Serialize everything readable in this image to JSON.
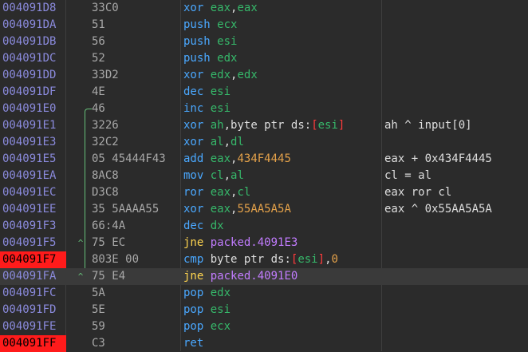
{
  "rows": [
    {
      "addr": "004091D8",
      "bytes": "33C0",
      "asm": [
        {
          "t": "mn",
          "v": "xor"
        },
        {
          "t": "sp",
          "v": " "
        },
        {
          "t": "reg",
          "v": "eax"
        },
        {
          "t": "txt",
          "v": ","
        },
        {
          "t": "reg",
          "v": "eax"
        }
      ],
      "comment": ""
    },
    {
      "addr": "004091DA",
      "bytes": "51",
      "asm": [
        {
          "t": "mn",
          "v": "push"
        },
        {
          "t": "sp",
          "v": " "
        },
        {
          "t": "reg",
          "v": "ecx"
        }
      ],
      "comment": ""
    },
    {
      "addr": "004091DB",
      "bytes": "56",
      "asm": [
        {
          "t": "mn",
          "v": "push"
        },
        {
          "t": "sp",
          "v": " "
        },
        {
          "t": "reg",
          "v": "esi"
        }
      ],
      "comment": ""
    },
    {
      "addr": "004091DC",
      "bytes": "52",
      "asm": [
        {
          "t": "mn",
          "v": "push"
        },
        {
          "t": "sp",
          "v": " "
        },
        {
          "t": "reg",
          "v": "edx"
        }
      ],
      "comment": ""
    },
    {
      "addr": "004091DD",
      "bytes": "33D2",
      "asm": [
        {
          "t": "mn",
          "v": "xor"
        },
        {
          "t": "sp",
          "v": " "
        },
        {
          "t": "reg",
          "v": "edx"
        },
        {
          "t": "txt",
          "v": ","
        },
        {
          "t": "reg",
          "v": "edx"
        }
      ],
      "comment": ""
    },
    {
      "addr": "004091DF",
      "bytes": "4E",
      "asm": [
        {
          "t": "mn",
          "v": "dec"
        },
        {
          "t": "sp",
          "v": " "
        },
        {
          "t": "reg",
          "v": "esi"
        }
      ],
      "comment": ""
    },
    {
      "addr": "004091E0",
      "bytes": "46",
      "asm": [
        {
          "t": "mn",
          "v": "inc"
        },
        {
          "t": "sp",
          "v": " "
        },
        {
          "t": "reg",
          "v": "esi"
        }
      ],
      "comment": ""
    },
    {
      "addr": "004091E1",
      "bytes": "3226",
      "asm": [
        {
          "t": "mn",
          "v": "xor"
        },
        {
          "t": "sp",
          "v": " "
        },
        {
          "t": "reg",
          "v": "ah"
        },
        {
          "t": "txt",
          "v": ","
        },
        {
          "t": "ptr",
          "v": "byte ptr "
        },
        {
          "t": "seg",
          "v": "ds:"
        },
        {
          "t": "br",
          "v": "["
        },
        {
          "t": "reg",
          "v": "esi"
        },
        {
          "t": "br",
          "v": "]"
        }
      ],
      "comment": "ah ^ input[0]"
    },
    {
      "addr": "004091E3",
      "bytes": "32C2",
      "asm": [
        {
          "t": "mn",
          "v": "xor"
        },
        {
          "t": "sp",
          "v": " "
        },
        {
          "t": "reg",
          "v": "al"
        },
        {
          "t": "txt",
          "v": ","
        },
        {
          "t": "reg",
          "v": "dl"
        }
      ],
      "comment": ""
    },
    {
      "addr": "004091E5",
      "bytes": "05 45444F43",
      "asm": [
        {
          "t": "mn",
          "v": "add"
        },
        {
          "t": "sp",
          "v": " "
        },
        {
          "t": "reg",
          "v": "eax"
        },
        {
          "t": "txt",
          "v": ","
        },
        {
          "t": "imm",
          "v": "434F4445"
        }
      ],
      "comment": "eax + 0x434F4445"
    },
    {
      "addr": "004091EA",
      "bytes": "8AC8",
      "asm": [
        {
          "t": "mn",
          "v": "mov"
        },
        {
          "t": "sp",
          "v": " "
        },
        {
          "t": "reg",
          "v": "cl"
        },
        {
          "t": "txt",
          "v": ","
        },
        {
          "t": "reg",
          "v": "al"
        }
      ],
      "comment": "cl = al"
    },
    {
      "addr": "004091EC",
      "bytes": "D3C8",
      "asm": [
        {
          "t": "mn",
          "v": "ror"
        },
        {
          "t": "sp",
          "v": " "
        },
        {
          "t": "reg",
          "v": "eax"
        },
        {
          "t": "txt",
          "v": ","
        },
        {
          "t": "reg",
          "v": "cl"
        }
      ],
      "comment": "eax ror cl"
    },
    {
      "addr": "004091EE",
      "bytes": "35 5AAAA55",
      "asm": [
        {
          "t": "mn",
          "v": "xor"
        },
        {
          "t": "sp",
          "v": " "
        },
        {
          "t": "reg",
          "v": "eax"
        },
        {
          "t": "txt",
          "v": ","
        },
        {
          "t": "imm",
          "v": "55AA5A5A"
        }
      ],
      "comment": "eax ^ 0x55AA5A5A"
    },
    {
      "addr": "004091F3",
      "bytes": "66:4A",
      "asm": [
        {
          "t": "mn",
          "v": "dec"
        },
        {
          "t": "sp",
          "v": " "
        },
        {
          "t": "reg",
          "v": "dx"
        }
      ],
      "comment": ""
    },
    {
      "addr": "004091F5",
      "bytes": "75 EC",
      "asm": [
        {
          "t": "mnj",
          "v": "jne"
        },
        {
          "t": "sp",
          "v": " "
        },
        {
          "t": "lbl",
          "v": "packed.4091E3"
        }
      ],
      "comment": "",
      "mark": "^"
    },
    {
      "addr": "004091F7",
      "bytes": "803E 00",
      "asm": [
        {
          "t": "mn",
          "v": "cmp"
        },
        {
          "t": "sp",
          "v": " "
        },
        {
          "t": "ptr",
          "v": "byte ptr "
        },
        {
          "t": "seg",
          "v": "ds:"
        },
        {
          "t": "br",
          "v": "["
        },
        {
          "t": "reg",
          "v": "esi"
        },
        {
          "t": "br",
          "v": "]"
        },
        {
          "t": "txt",
          "v": ","
        },
        {
          "t": "num",
          "v": "0"
        }
      ],
      "comment": "",
      "bp": true
    },
    {
      "addr": "004091FA",
      "bytes": "75 E4",
      "asm": [
        {
          "t": "mnj",
          "v": "jne"
        },
        {
          "t": "sp",
          "v": " "
        },
        {
          "t": "lbl",
          "v": "packed.4091E0"
        }
      ],
      "comment": "",
      "hl": true,
      "mark": "^"
    },
    {
      "addr": "004091FC",
      "bytes": "5A",
      "asm": [
        {
          "t": "mn",
          "v": "pop"
        },
        {
          "t": "sp",
          "v": " "
        },
        {
          "t": "reg",
          "v": "edx"
        }
      ],
      "comment": ""
    },
    {
      "addr": "004091FD",
      "bytes": "5E",
      "asm": [
        {
          "t": "mn",
          "v": "pop"
        },
        {
          "t": "sp",
          "v": " "
        },
        {
          "t": "reg",
          "v": "esi"
        }
      ],
      "comment": ""
    },
    {
      "addr": "004091FE",
      "bytes": "59",
      "asm": [
        {
          "t": "mn",
          "v": "pop"
        },
        {
          "t": "sp",
          "v": " "
        },
        {
          "t": "reg",
          "v": "ecx"
        }
      ],
      "comment": ""
    },
    {
      "addr": "004091FF",
      "bytes": "C3",
      "asm": [
        {
          "t": "mn",
          "v": "ret"
        }
      ],
      "comment": "",
      "bp": true
    }
  ],
  "colors": {
    "background": "#2b2b2b",
    "address": "#8a8adc",
    "breakpoint": "#ff1b1b",
    "mnemonic": "#4aa8ff",
    "register": "#36b86a",
    "immediate": "#e5a24a",
    "label": "#c27cff",
    "jump_arrow": "#66c07a"
  }
}
